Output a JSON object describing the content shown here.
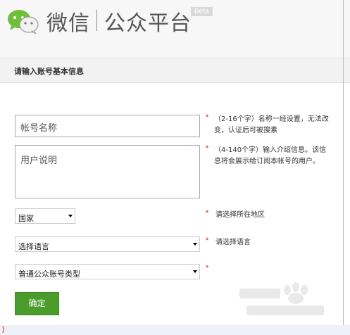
{
  "header": {
    "brand_name": "微信",
    "brand_sub": "公众平台",
    "beta": "Beta"
  },
  "section": {
    "title": "请输入账号基本信息"
  },
  "form": {
    "account_name_placeholder": "帐号名称",
    "description_placeholder": "用户说明",
    "country_value": "国家",
    "language_value": "选择语言",
    "account_type_value": "普通公众账号类型",
    "submit_label": "确定"
  },
  "hints": {
    "required_mark": "*",
    "name_hint_line1": "（2-16个字）名称一经设置，无法改",
    "name_hint_line2": "变，认证后可被搜素",
    "desc_hint_line1": "（4-140个字）输入介绍信息。该信",
    "desc_hint_line2": "息将会展示给订阅本帐号的用户。",
    "country_hint": "请选择所在地区",
    "language_hint": "请选择语言"
  },
  "footer": {
    "mark": ")"
  },
  "colors": {
    "brand_green": "#4a9d2b",
    "required_red": "#d21"
  },
  "icons": {
    "logo": "wechat-logo-icon",
    "caret": "chevron-down-icon"
  }
}
